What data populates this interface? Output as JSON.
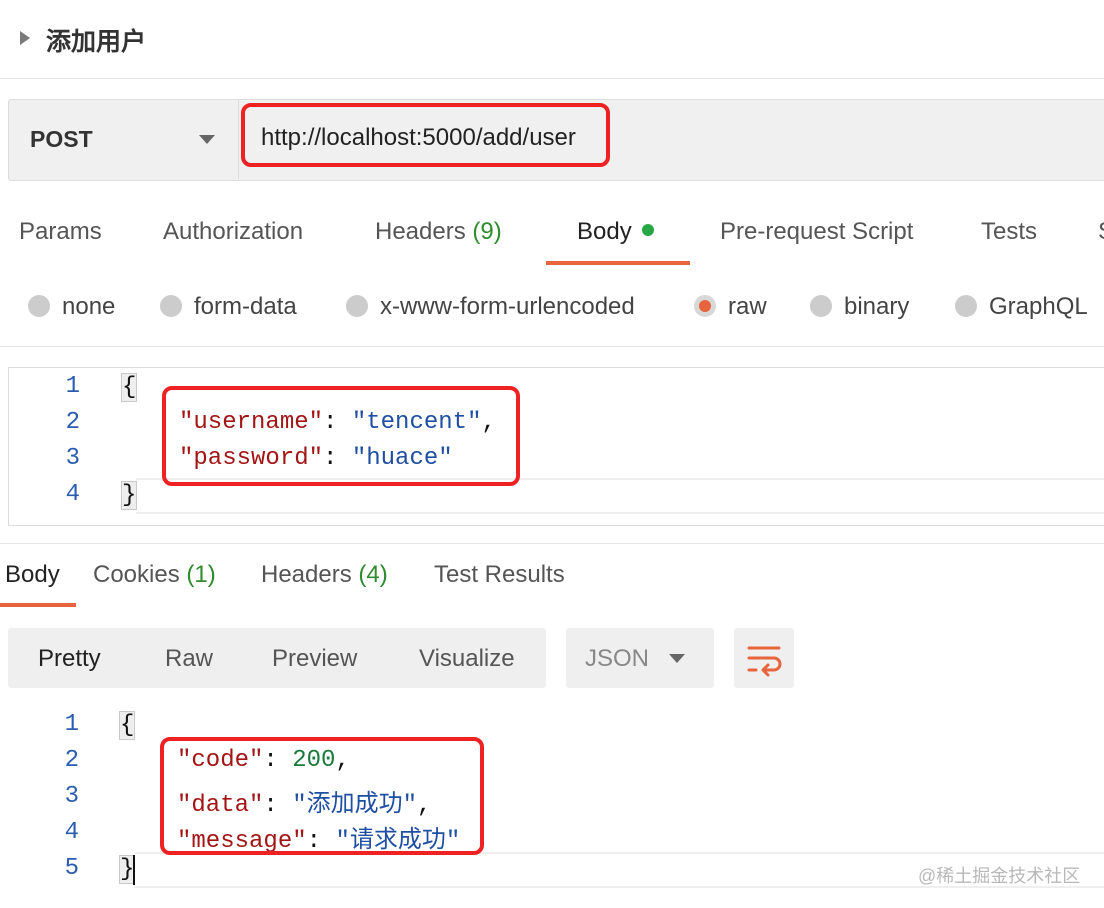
{
  "request": {
    "title": "添加用户",
    "method": "POST",
    "url": "http://localhost:5000/add/user"
  },
  "request_tabs": [
    {
      "label": "Params"
    },
    {
      "label": "Authorization"
    },
    {
      "label": "Headers",
      "count": "(9)"
    },
    {
      "label": "Body"
    },
    {
      "label": "Pre-request Script"
    },
    {
      "label": "Tests"
    },
    {
      "label": "S"
    }
  ],
  "body_types": [
    "none",
    "form-data",
    "x-www-form-urlencoded",
    "raw",
    "binary",
    "GraphQL"
  ],
  "selected_body_type": "raw",
  "request_body": {
    "line_numbers": [
      "1",
      "2",
      "3",
      "4"
    ],
    "open_brace": "{",
    "close_brace": "}",
    "fields": [
      {
        "key": "\"username\"",
        "value": "\"tencent\"",
        "trail": ","
      },
      {
        "key": "\"password\"",
        "value": "\"huace\"",
        "trail": ""
      }
    ]
  },
  "response_tabs": [
    {
      "label": "Body"
    },
    {
      "label": "Cookies",
      "count": "(1)"
    },
    {
      "label": "Headers",
      "count": "(4)"
    },
    {
      "label": "Test Results"
    }
  ],
  "view_modes": [
    "Pretty",
    "Raw",
    "Preview",
    "Visualize"
  ],
  "format": "JSON",
  "response_body": {
    "line_numbers": [
      "1",
      "2",
      "3",
      "4",
      "5"
    ],
    "open_brace": "{",
    "close_brace": "}",
    "fields": [
      {
        "key": "\"code\"",
        "value": "200",
        "trail": ","
      },
      {
        "key": "\"data\"",
        "value": "\"添加成功\"",
        "trail": ","
      },
      {
        "key": "\"message\"",
        "value": "\"请求成功\"",
        "trail": ""
      }
    ]
  },
  "watermark": "@稀土掘金技术社区",
  "colors": {
    "accent": "#e8643c",
    "highlight_box": "#ee2222",
    "count_green": "#2e8b2e"
  }
}
